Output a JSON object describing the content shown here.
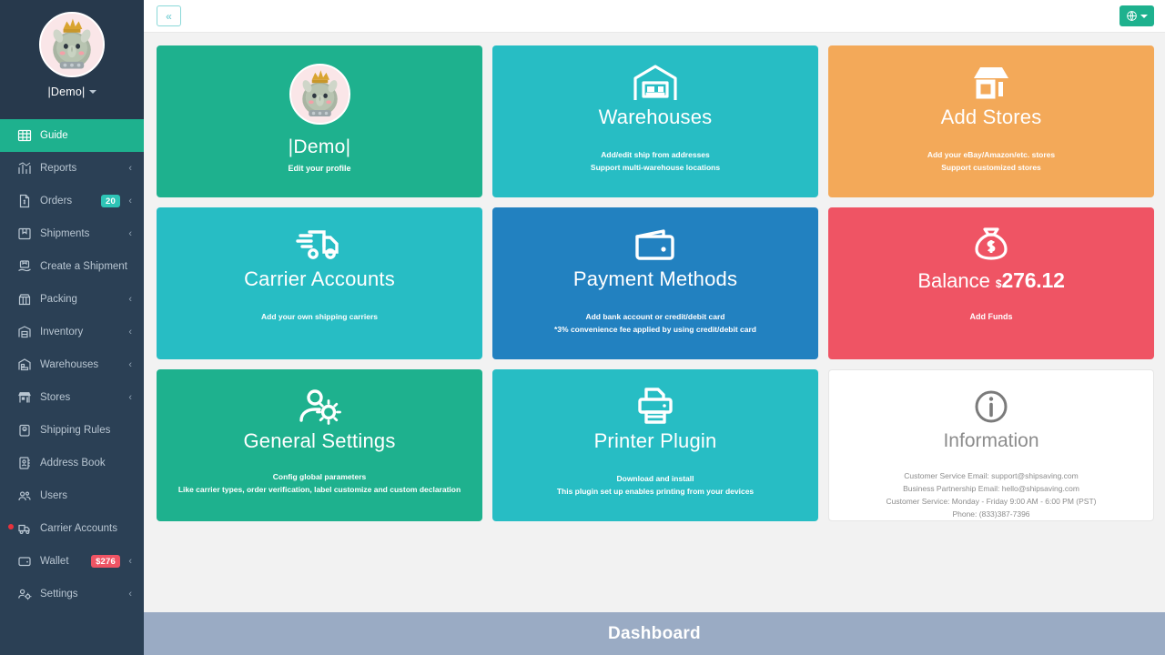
{
  "theme": {
    "sidebar_bg": "#2b4055",
    "sidebar_profile_bg": "#27394c",
    "accent_green": "#1eb18e",
    "accent_teal": "#27bdc4",
    "accent_orange": "#f3a959",
    "accent_blue": "#2281c0",
    "accent_red": "#ef5464",
    "bottom_bar": "#9aabc4"
  },
  "sidebar": {
    "profile": {
      "name": "|Demo|",
      "avatar_icon": "rhino-avatar",
      "caret_icon": "caret-down-icon"
    },
    "items": [
      {
        "label": "Guide",
        "icon": "grid-icon",
        "active": true,
        "chevron": false,
        "badge": null,
        "badge_color": null,
        "dot": false
      },
      {
        "label": "Reports",
        "icon": "bar-chart-icon",
        "active": false,
        "chevron": true,
        "badge": null,
        "badge_color": null,
        "dot": false
      },
      {
        "label": "Orders",
        "icon": "invoice-icon",
        "active": false,
        "chevron": true,
        "badge": "20",
        "badge_color": "teal",
        "dot": false
      },
      {
        "label": "Shipments",
        "icon": "box-icon",
        "active": false,
        "chevron": true,
        "badge": null,
        "badge_color": null,
        "dot": false
      },
      {
        "label": "Create a Shipment",
        "icon": "create-shipment-icon",
        "active": false,
        "chevron": false,
        "badge": null,
        "badge_color": null,
        "dot": false
      },
      {
        "label": "Packing",
        "icon": "open-box-icon",
        "active": false,
        "chevron": true,
        "badge": null,
        "badge_color": null,
        "dot": false
      },
      {
        "label": "Inventory",
        "icon": "inventory-icon",
        "active": false,
        "chevron": true,
        "badge": null,
        "badge_color": null,
        "dot": false
      },
      {
        "label": "Warehouses",
        "icon": "warehouse-icon",
        "active": false,
        "chevron": true,
        "badge": null,
        "badge_color": null,
        "dot": false
      },
      {
        "label": "Stores",
        "icon": "store-icon",
        "active": false,
        "chevron": true,
        "badge": null,
        "badge_color": null,
        "dot": false
      },
      {
        "label": "Shipping Rules",
        "icon": "clipboard-icon",
        "active": false,
        "chevron": false,
        "badge": null,
        "badge_color": null,
        "dot": false
      },
      {
        "label": "Address Book",
        "icon": "address-book-icon",
        "active": false,
        "chevron": false,
        "badge": null,
        "badge_color": null,
        "dot": false
      },
      {
        "label": "Users",
        "icon": "users-icon",
        "active": false,
        "chevron": false,
        "badge": null,
        "badge_color": null,
        "dot": false
      },
      {
        "label": "Carrier Accounts",
        "icon": "truck-icon",
        "active": false,
        "chevron": false,
        "badge": null,
        "badge_color": null,
        "dot": true
      },
      {
        "label": "Wallet",
        "icon": "wallet-icon",
        "active": false,
        "chevron": true,
        "badge": "$276",
        "badge_color": "red",
        "dot": false
      },
      {
        "label": "Settings",
        "icon": "user-gear-icon",
        "active": false,
        "chevron": true,
        "badge": null,
        "badge_color": null,
        "dot": false
      }
    ]
  },
  "topbar": {
    "collapse_label": "«",
    "collapse_icon": "chevron-double-left-icon",
    "language_icon": "globe-icon",
    "language_caret_icon": "caret-down-icon"
  },
  "tiles": {
    "profile": {
      "name": "|Demo|",
      "sub": "Edit your profile",
      "avatar_icon": "rhino-avatar",
      "color": "#1eb18e"
    },
    "warehouses": {
      "title": "Warehouses",
      "icon": "warehouse-icon",
      "sub1": "Add/edit ship from addresses",
      "sub2": "Support multi-warehouse locations",
      "color": "#27bdc4"
    },
    "add_stores": {
      "title": "Add Stores",
      "icon": "storefront-icon",
      "sub1": "Add your eBay/Amazon/etc. stores",
      "sub2": "Support customized stores",
      "color": "#f3a959"
    },
    "carrier_accounts": {
      "title": "Carrier Accounts",
      "icon": "fast-truck-icon",
      "sub1": "Add your own shipping carriers",
      "color": "#27bdc4"
    },
    "payment_methods": {
      "title": "Payment Methods",
      "icon": "wallet-icon",
      "sub1": "Add bank account or credit/debit card",
      "sub2": "*3% convenience fee applied by using credit/debit card",
      "color": "#2281c0"
    },
    "balance": {
      "title": "Balance",
      "currency": "$",
      "amount": "276.12",
      "icon": "money-bag-icon",
      "sub1": "Add Funds",
      "color": "#ef5464"
    },
    "general_settings": {
      "title": "General Settings",
      "icon": "user-gear-icon",
      "sub1": "Config global parameters",
      "sub2": "Like carrier types, order verification, label customize and custom declaration",
      "color": "#1eb18e"
    },
    "printer_plugin": {
      "title": "Printer Plugin",
      "icon": "printer-icon",
      "sub1": "Download and install",
      "sub2": "This plugin set up enables printing from your devices",
      "color": "#27bdc4"
    },
    "information": {
      "title": "Information",
      "icon": "info-circle-icon",
      "line1": "Customer Service Email: support@shipsaving.com",
      "line2": "Business Partnership Email: hello@shipsaving.com",
      "line3": "Customer Service: Monday - Friday 9:00 AM - 6:00 PM (PST)",
      "line4": "Phone: (833)387-7396",
      "color": "#ffffff"
    }
  },
  "bottom_bar": {
    "title": "Dashboard"
  }
}
